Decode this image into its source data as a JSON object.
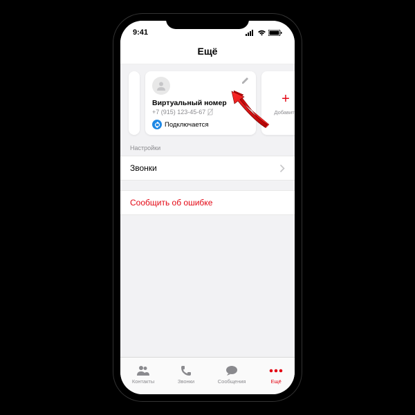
{
  "status_bar": {
    "time": "9:41"
  },
  "header": {
    "title": "Ещё"
  },
  "virtual_card": {
    "title": "Виртуальный номер",
    "phone": "+7 (915) 123-45-67",
    "status": "Подключается"
  },
  "add_card": {
    "label": "Добавить"
  },
  "settings": {
    "section_label": "Настройки",
    "calls_row": "Звонки"
  },
  "report": {
    "label": "Сообщить об ошибке"
  },
  "tabbar": {
    "contacts": "Контакты",
    "calls": "Звонки",
    "messages": "Сообщения",
    "more": "Ещё"
  },
  "colors": {
    "accent": "#e30613",
    "blue": "#1e88e5"
  }
}
